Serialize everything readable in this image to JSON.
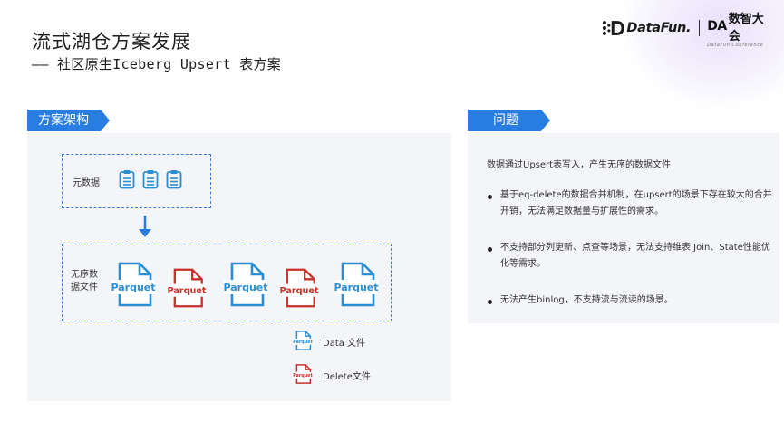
{
  "slide": {
    "title": "流式湖仓方案发展",
    "subtitle": "——  社区原生Iceberg Upsert 表方案"
  },
  "brand": {
    "datafun": "DataFun.",
    "da": "DA",
    "da_cn": "数智大会",
    "da_sub": "DataFun Conference"
  },
  "left": {
    "tag": "方案架构",
    "meta_label": "元数据",
    "data_label": "无序数据文件",
    "parquet_text": "Parquet",
    "files": [
      "data",
      "delete",
      "data",
      "delete",
      "data"
    ],
    "legend": [
      {
        "kind": "data",
        "label": "Data 文件"
      },
      {
        "kind": "delete",
        "label": "Delete文件"
      }
    ]
  },
  "right": {
    "tag": "问题",
    "intro": "数据通过Upsert表写入，产生无序的数据文件",
    "items": [
      "基于eq-delete的数据合并机制，在upsert的场景下存在较大的合并开销，无法满足数据量与扩展性的需求。",
      "不支持部分列更新、点查等场景，无法支持维表 Join、State性能优化等需求。",
      "无法产生binlog，不支持流与流读的场景。"
    ]
  },
  "colors": {
    "accent": "#2a7de0",
    "data_file": "#2a8ed4",
    "delete_file": "#c8312b",
    "panel": "#f4f5f8"
  }
}
